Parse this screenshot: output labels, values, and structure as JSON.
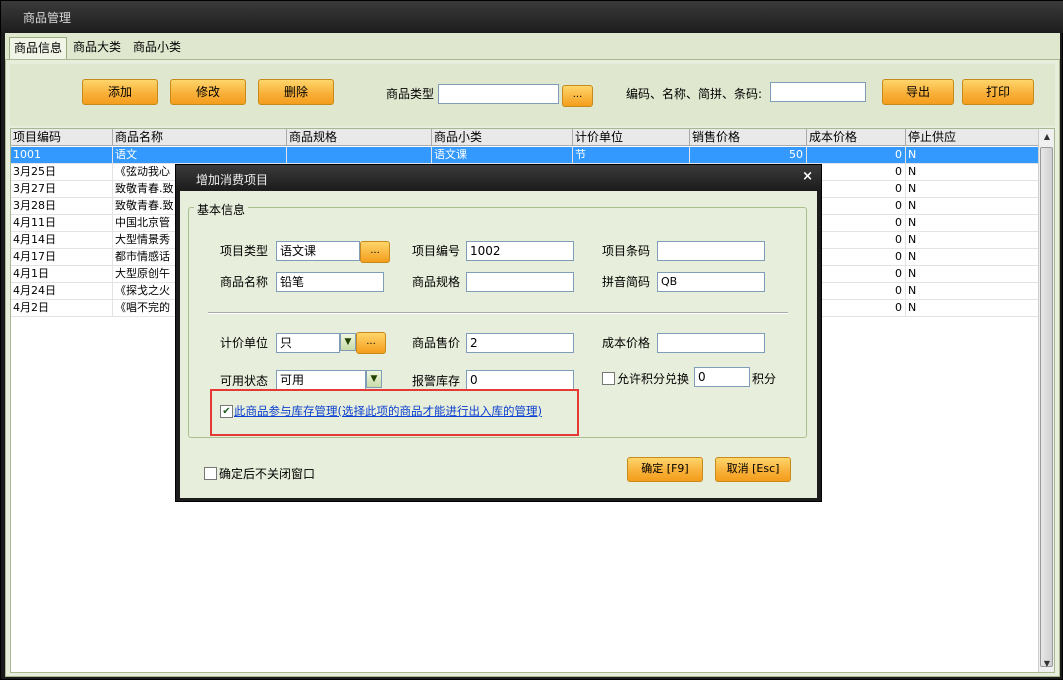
{
  "window": {
    "title": "商品管理"
  },
  "tabs": [
    {
      "label": "商品信息"
    },
    {
      "label": "商品大类"
    },
    {
      "label": "商品小类"
    }
  ],
  "toolbar": {
    "add_label": "添加",
    "edit_label": "修改",
    "delete_label": "删除",
    "type_label": "商品类型",
    "type_value": "",
    "dots_label": "...",
    "search_label": "编码、名称、简拼、条码:",
    "search_value": "",
    "export_label": "导出",
    "print_label": "打印"
  },
  "grid": {
    "columns": [
      "项目编码",
      "商品名称",
      "商品规格",
      "商品小类",
      "计价单位",
      "销售价格",
      "成本价格",
      "停止供应"
    ],
    "rows": [
      [
        "1001",
        "语文",
        "",
        "语文课",
        "节",
        "50",
        "0",
        "N"
      ],
      [
        "3月25日",
        "《弦动我心",
        "",
        "",
        "",
        "",
        "0",
        "N"
      ],
      [
        "3月27日",
        "致敬青春.致",
        "",
        "",
        "",
        "",
        "0",
        "N"
      ],
      [
        "3月28日",
        "致敬青春.致",
        "",
        "",
        "",
        "",
        "0",
        "N"
      ],
      [
        "4月11日",
        "中国北京管",
        "",
        "",
        "",
        "",
        "0",
        "N"
      ],
      [
        "4月14日",
        "大型情景秀",
        "",
        "",
        "",
        "",
        "0",
        "N"
      ],
      [
        "4月17日",
        "都市情感话",
        "",
        "",
        "",
        "",
        "0",
        "N"
      ],
      [
        "4月1日",
        "大型原创午",
        "",
        "",
        "",
        "",
        "0",
        "N"
      ],
      [
        "4月24日",
        "《探戈之火",
        "",
        "",
        "",
        "",
        "0",
        "N"
      ],
      [
        "4月2日",
        "《唱不完的",
        "",
        "",
        "",
        "",
        "0",
        "N"
      ]
    ]
  },
  "dialog": {
    "title": "增加消费项目",
    "close_glyph": "×",
    "group_label": "基本信息",
    "item_type_label": "项目类型",
    "item_type_value": "语文课",
    "item_code_label": "项目编号",
    "item_code_value": "1002",
    "item_barcode_label": "项目条码",
    "item_barcode_value": "",
    "name_label": "商品名称",
    "name_value": "铅笔",
    "spec_label": "商品规格",
    "spec_value": "",
    "pinyin_label": "拼音简码",
    "pinyin_value": "QB",
    "unit_label": "计价单位",
    "unit_value": "只",
    "price_label": "商品售价",
    "price_value": "2",
    "cost_label": "成本价格",
    "cost_value": "",
    "status_label": "可用状态",
    "status_value": "可用",
    "alarm_label": "报警库存",
    "alarm_value": "0",
    "points_label": "允许积分兑换",
    "points_value": "0",
    "points_unit": "积分",
    "stock_check_label": "此商品参与库存管理(选择此项的商品才能进行出入库的管理)",
    "stock_checked": true,
    "keep_open_label": "确定后不关闭窗口",
    "keep_open_checked": false,
    "ok_label": "确定 [F9]",
    "cancel_label": "取消 [Esc]",
    "check_glyph": "✔",
    "arrow_glyph": "▼"
  }
}
